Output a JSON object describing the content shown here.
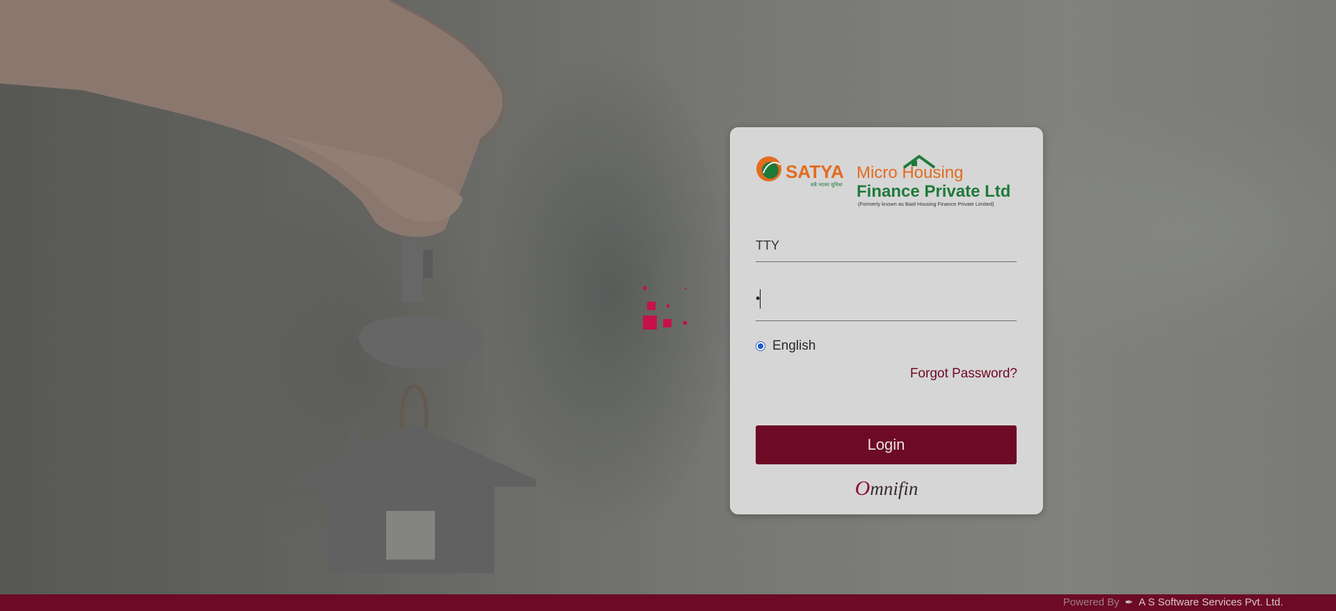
{
  "colors": {
    "brand": "#6d0a25",
    "loader": "#c8104a",
    "radio_accent": "#1e57c7"
  },
  "login": {
    "brand": {
      "satya": "SATYA",
      "tagline": "सबै भएका सुविधा",
      "micro_housing": "Micro Housing",
      "finance_line": "Finance Private Ltd",
      "formerly": "(Formerly known as Baid Housing Finance Private Limited)"
    },
    "username_value": "TTY",
    "password_mask": "•",
    "language": {
      "label": "English",
      "selected": true
    },
    "forgot_label": "Forgot Password?",
    "login_label": "Login",
    "vendor_logo": {
      "first_letter": "O",
      "rest": "mnifin"
    }
  },
  "footer": {
    "powered_by": "Powered By",
    "pen_icon": "pen-icon",
    "company": "A S Software Services Pvt. Ltd."
  }
}
